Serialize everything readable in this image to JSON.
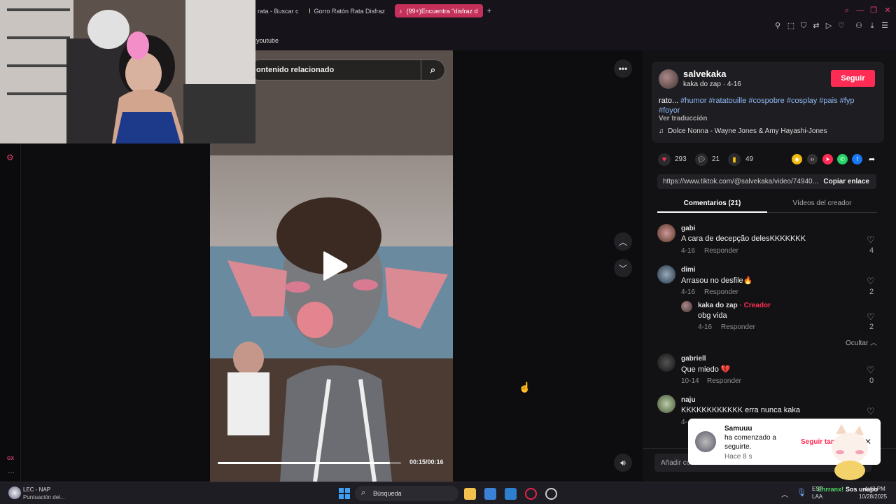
{
  "browser": {
    "tabs": [
      {
        "label": "rata - Buscar c"
      },
      {
        "label": "Gorro Ratón Rata Disfraz"
      },
      {
        "label": "(99+)Encuentra \"disfraz d"
      }
    ],
    "new_tab": "+",
    "bookmark": "youtube"
  },
  "video": {
    "search_placeholder": "ontenido relacionado",
    "timecode": "00:15/00:16",
    "progress": 0.94
  },
  "author": {
    "username": "salvekaka",
    "subtitle": "kaka do zap · 4-16",
    "follow_label": "Seguir",
    "caption_prefix": "rato...",
    "hashtags_line1": "#humor #ratatouille #cospobre #cosplay #pais #fyp",
    "hashtags_line2": "#foyor",
    "translate": "Ver traducción",
    "music": "Dolce Nonna - Wayne Jones & Amy Hayashi-Jones"
  },
  "stats": {
    "likes": "293",
    "comments": "21",
    "saves": "49"
  },
  "share": {
    "url": "https://www.tiktok.com/@salvekaka/video/74940...",
    "copy_label": "Copiar enlace"
  },
  "tabs": {
    "comments": "Comentarios (21)",
    "creator_videos": "Vídeos del creador"
  },
  "comments": [
    {
      "user": "gabi",
      "text": "A cara de decepção delesKKKKKKK",
      "date": "4-16",
      "reply": "Responder",
      "likes": "4"
    },
    {
      "user": "dimi",
      "text": "Arrasou no desfile🔥",
      "date": "4-16",
      "reply": "Responder",
      "likes": "2"
    },
    {
      "user": "kaka do zap",
      "creator_tag": "· Creador",
      "text": "obg vida",
      "date": "4-16",
      "reply": "Responder",
      "likes": "2"
    },
    {
      "user": "gabriell",
      "text": "Que miedo 💔",
      "date": "10-14",
      "reply": "Responder",
      "likes": "0"
    },
    {
      "user": "naju",
      "text": "KKKKKKKKKKKK erra nunca kaka",
      "date": "4-",
      "reply": "",
      "likes": ""
    }
  ],
  "hide_label": "Ocultar",
  "add_comment": "Añadir co",
  "toast": {
    "name": "Samuuu",
    "line1": "ha comenzado a",
    "line2": "seguirte.",
    "time": "Hace 8 s",
    "action": "Seguir tam"
  },
  "taskbar": {
    "weather_title": "LEC - NAP",
    "weather_sub": "Puntuación del...",
    "search_label": "Búsqueda",
    "lang_top": "ESP",
    "lang_bottom": "LAA",
    "time": "4:43 PM",
    "date": "10/28/2025",
    "overlay_text": "Sos unapo",
    "overlay_green": "Enrranx!"
  },
  "colors": {
    "accent": "#fe2c55",
    "link": "#8fb8f5",
    "tab_active": "#c5305a"
  }
}
